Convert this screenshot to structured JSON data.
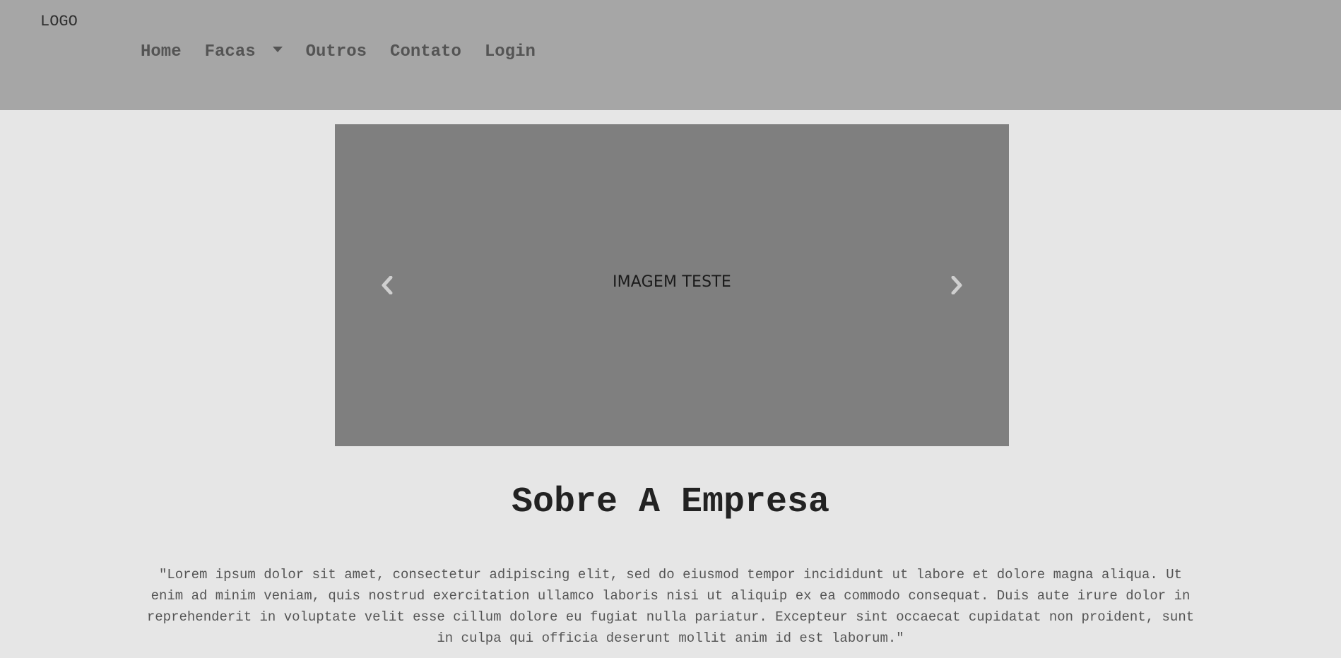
{
  "header": {
    "logo": "LOGO",
    "nav": {
      "home": "Home",
      "facas": "Facas",
      "outros": "Outros",
      "contato": "Contato",
      "login": "Login"
    }
  },
  "carousel": {
    "caption": "IMAGEM TESTE",
    "prev_icon": "chevron-left-icon",
    "next_icon": "chevron-right-icon"
  },
  "about": {
    "title": "Sobre A Empresa",
    "text": "\"Lorem ipsum dolor sit amet, consectetur adipiscing elit, sed do eiusmod tempor incididunt ut labore et dolore magna aliqua. Ut enim ad minim veniam, quis nostrud exercitation ullamco laboris nisi ut aliquip ex ea commodo consequat. Duis aute irure dolor in reprehenderit in voluptate velit esse cillum dolore eu fugiat nulla pariatur. Excepteur sint occaecat cupidatat non proident, sunt in culpa qui officia deserunt mollit anim id est laborum.\""
  },
  "colors": {
    "header_bg": "#a6a6a6",
    "page_bg": "#e6e6e6",
    "carousel_bg": "#7f7f7f"
  }
}
